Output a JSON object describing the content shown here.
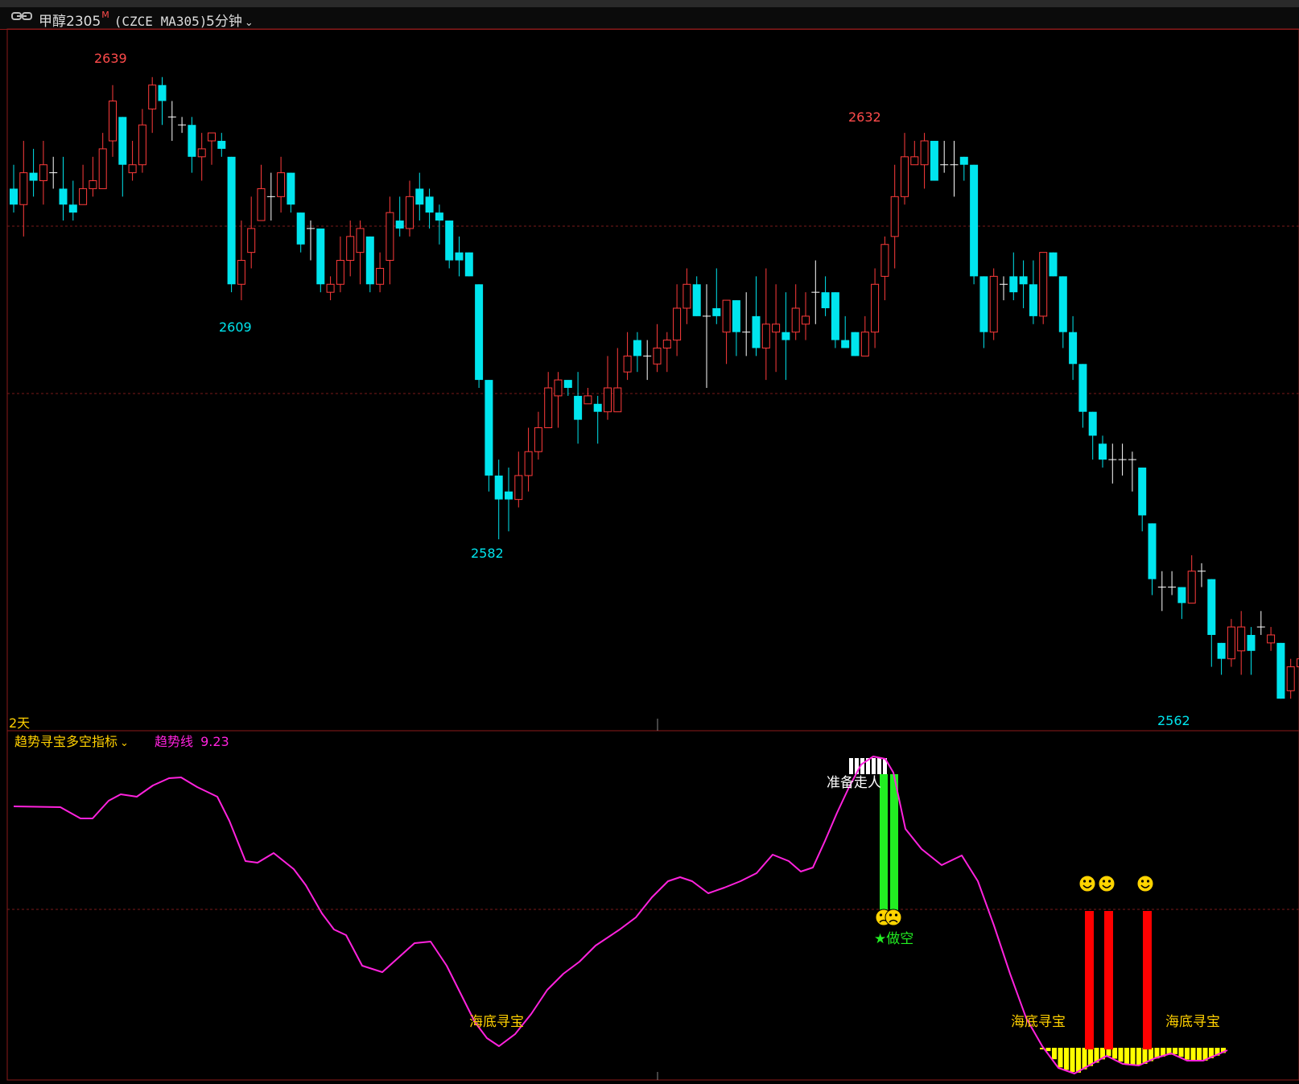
{
  "header": {
    "link_icon": "link-icon",
    "instrument": "甲醇2305",
    "marker": "M",
    "code": "(CZCE MA305)",
    "period": "5分钟",
    "period_dropdown_icon": "chevron-down-icon"
  },
  "colors": {
    "up": "#ff3b3b",
    "down": "#00e5ee",
    "flat": "#ffffff",
    "frame": "#8b1a1a",
    "grid": "#7a1a1a",
    "trend": "#ff22dd",
    "indicator_title": "#ffd000",
    "bottom_fill": "#ffff00",
    "short_bar": "#22ee22",
    "buy_bar": "#ff0000"
  },
  "main_panel": {
    "period_label": "2天",
    "labels": {
      "high1": "2639",
      "low1": "2609",
      "low2": "2582",
      "high2": "2632",
      "low3": "2562"
    }
  },
  "indicator": {
    "name": "趋势寻宝多空指标",
    "series_label": "趋势线",
    "series_value": "9.23",
    "texts": {
      "ready_exit": "准备走人",
      "short_signal": "★做空",
      "bottom_1": "海底寻宝",
      "bottom_2": "海底寻宝",
      "bottom_3": "海底寻宝"
    },
    "icons": [
      "smiley-icon",
      "sad-face-icon"
    ]
  },
  "chart_data": {
    "type": "candlestick",
    "instrument": "甲醇2305",
    "period": "5分钟",
    "ylim": [
      2560,
      2642
    ],
    "annotations": [
      {
        "label": "2639",
        "kind": "high"
      },
      {
        "label": "2609",
        "kind": "low"
      },
      {
        "label": "2582",
        "kind": "low"
      },
      {
        "label": "2632",
        "kind": "high"
      },
      {
        "label": "2562",
        "kind": "low"
      }
    ],
    "candles": [
      [
        2626,
        2624,
        2629,
        2623
      ],
      [
        2624,
        2628,
        2632,
        2620
      ],
      [
        2628,
        2627,
        2631,
        2625
      ],
      [
        2627,
        2629,
        2632,
        2624
      ],
      [
        2628,
        2628,
        2630,
        2626
      ],
      [
        2626,
        2624,
        2630,
        2622
      ],
      [
        2624,
        2623,
        2627,
        2622
      ],
      [
        2624,
        2626,
        2629,
        2624
      ],
      [
        2626,
        2627,
        2630,
        2625
      ],
      [
        2626,
        2631,
        2633,
        2626
      ],
      [
        2632,
        2637,
        2639,
        2630
      ],
      [
        2635,
        2629,
        2635,
        2625
      ],
      [
        2628,
        2629,
        2632,
        2627
      ],
      [
        2629,
        2634,
        2636,
        2628
      ],
      [
        2636,
        2639,
        2640,
        2633
      ],
      [
        2639,
        2637,
        2640,
        2634
      ],
      [
        2635,
        2635,
        2637,
        2632
      ],
      [
        2634,
        2634,
        2635,
        2633
      ],
      [
        2634,
        2630,
        2635,
        2628
      ],
      [
        2630,
        2631,
        2633,
        2627
      ],
      [
        2632,
        2633,
        2633,
        2629
      ],
      [
        2632,
        2631,
        2633,
        2630
      ],
      [
        2630,
        2614,
        2630,
        2613
      ],
      [
        2614,
        2617,
        2622,
        2612
      ],
      [
        2618,
        2621,
        2625,
        2616
      ],
      [
        2622,
        2626,
        2629,
        2622
      ],
      [
        2625,
        2625,
        2628,
        2622
      ],
      [
        2625,
        2628,
        2630,
        2623
      ],
      [
        2628,
        2624,
        2628,
        2623
      ],
      [
        2623,
        2619,
        2623,
        2618
      ],
      [
        2621,
        2621,
        2622,
        2617
      ],
      [
        2621,
        2614,
        2621,
        2613
      ],
      [
        2613,
        2614,
        2615,
        2612
      ],
      [
        2614,
        2617,
        2620,
        2613
      ],
      [
        2617,
        2620,
        2622,
        2615
      ],
      [
        2618,
        2621,
        2622,
        2614
      ],
      [
        2620,
        2614,
        2620,
        2613
      ],
      [
        2614,
        2616,
        2618,
        2613
      ],
      [
        2617,
        2623,
        2625,
        2614
      ],
      [
        2622,
        2621,
        2625,
        2620
      ],
      [
        2621,
        2625,
        2627,
        2620
      ],
      [
        2626,
        2624,
        2628,
        2622
      ],
      [
        2625,
        2623,
        2626,
        2621
      ],
      [
        2623,
        2622,
        2624,
        2619
      ],
      [
        2622,
        2617,
        2622,
        2616
      ],
      [
        2618,
        2617,
        2620,
        2615
      ],
      [
        2618,
        2615,
        2618,
        2615
      ],
      [
        2614,
        2602,
        2614,
        2601
      ],
      [
        2602,
        2590,
        2602,
        2588
      ],
      [
        2590,
        2587,
        2592,
        2582
      ],
      [
        2588,
        2587,
        2591,
        2583
      ],
      [
        2587,
        2590,
        2593,
        2586
      ],
      [
        2590,
        2593,
        2596,
        2588
      ],
      [
        2593,
        2596,
        2598,
        2592
      ],
      [
        2596,
        2601,
        2603,
        2596
      ],
      [
        2600,
        2602,
        2603,
        2596
      ],
      [
        2602,
        2601,
        2601,
        2600
      ],
      [
        2600,
        2597,
        2603,
        2594
      ],
      [
        2599,
        2600,
        2601,
        2599
      ],
      [
        2599,
        2598,
        2600,
        2594
      ],
      [
        2598,
        2601,
        2605,
        2597
      ],
      [
        2598,
        2601,
        2606,
        2598
      ],
      [
        2603,
        2605,
        2608,
        2602
      ],
      [
        2607,
        2605,
        2608,
        2603
      ],
      [
        2605,
        2605,
        2607,
        2602
      ],
      [
        2604,
        2606,
        2609,
        2603
      ],
      [
        2606,
        2607,
        2608,
        2603
      ],
      [
        2607,
        2611,
        2614,
        2605
      ],
      [
        2611,
        2614,
        2616,
        2609
      ],
      [
        2614,
        2610,
        2615,
        2610
      ],
      [
        2610,
        2610,
        2614,
        2601
      ],
      [
        2611,
        2610,
        2616,
        2609
      ],
      [
        2608,
        2612,
        2612,
        2604
      ],
      [
        2612,
        2608,
        2612,
        2605
      ],
      [
        2608,
        2608,
        2613,
        2605
      ],
      [
        2610,
        2606,
        2615,
        2605
      ],
      [
        2606,
        2609,
        2616,
        2602
      ],
      [
        2608,
        2609,
        2614,
        2603
      ],
      [
        2608,
        2607,
        2613,
        2602
      ],
      [
        2608,
        2611,
        2614,
        2607
      ],
      [
        2609,
        2610,
        2613,
        2607
      ],
      [
        2613,
        2613,
        2617,
        2609
      ],
      [
        2613,
        2611,
        2615,
        2610
      ],
      [
        2613,
        2607,
        2613,
        2606
      ],
      [
        2607,
        2606,
        2610,
        2606
      ],
      [
        2608,
        2605,
        2608,
        2605
      ],
      [
        2605,
        2608,
        2610,
        2605
      ],
      [
        2608,
        2614,
        2616,
        2606
      ],
      [
        2615,
        2619,
        2620,
        2612
      ],
      [
        2620,
        2625,
        2629,
        2616
      ],
      [
        2625,
        2630,
        2633,
        2624
      ],
      [
        2629,
        2630,
        2632,
        2629
      ],
      [
        2629,
        2632,
        2633,
        2626
      ],
      [
        2632,
        2627,
        2632,
        2627
      ],
      [
        2629,
        2629,
        2632,
        2628
      ],
      [
        2629,
        2629,
        2632,
        2625
      ],
      [
        2630,
        2629,
        2630,
        2627
      ],
      [
        2629,
        2615,
        2629,
        2614
      ],
      [
        2615,
        2608,
        2615,
        2606
      ],
      [
        2608,
        2615,
        2616,
        2607
      ],
      [
        2614,
        2614,
        2615,
        2612
      ],
      [
        2615,
        2613,
        2618,
        2612
      ],
      [
        2615,
        2614,
        2617,
        2611
      ],
      [
        2614,
        2610,
        2617,
        2609
      ],
      [
        2610,
        2618,
        2618,
        2609
      ],
      [
        2618,
        2615,
        2618,
        2615
      ],
      [
        2615,
        2608,
        2615,
        2606
      ],
      [
        2608,
        2604,
        2610,
        2602
      ],
      [
        2604,
        2598,
        2604,
        2596
      ],
      [
        2598,
        2595,
        2598,
        2592
      ],
      [
        2594,
        2592,
        2595,
        2591
      ],
      [
        2592,
        2592,
        2594,
        2589
      ],
      [
        2592,
        2592,
        2594,
        2590
      ],
      [
        2592,
        2592,
        2593,
        2588
      ],
      [
        2591,
        2585,
        2591,
        2583
      ],
      [
        2584,
        2577,
        2584,
        2575
      ],
      [
        2576,
        2576,
        2578,
        2573
      ],
      [
        2576,
        2576,
        2578,
        2575
      ],
      [
        2576,
        2574,
        2576,
        2572
      ],
      [
        2574,
        2578,
        2580,
        2574
      ],
      [
        2578,
        2578,
        2579,
        2576
      ],
      [
        2577,
        2570,
        2577,
        2566
      ],
      [
        2569,
        2567,
        2569,
        2565
      ],
      [
        2567,
        2571,
        2572,
        2566
      ],
      [
        2568,
        2571,
        2573,
        2565
      ],
      [
        2570,
        2568,
        2571,
        2565
      ],
      [
        2571,
        2571,
        2573,
        2570
      ],
      [
        2569,
        2570,
        2571,
        2568
      ],
      [
        2569,
        2562,
        2569,
        2562
      ],
      [
        2563,
        2566,
        2567,
        2562
      ],
      [
        2566,
        2567,
        2570,
        2566
      ],
      [
        2567,
        2568,
        2569,
        2564
      ],
      [
        2568,
        2566,
        2569,
        2566
      ],
      [
        2567,
        2570,
        2573,
        2566
      ]
    ],
    "trend_line": {
      "name": "趋势线",
      "last_value": 9.23
    }
  }
}
